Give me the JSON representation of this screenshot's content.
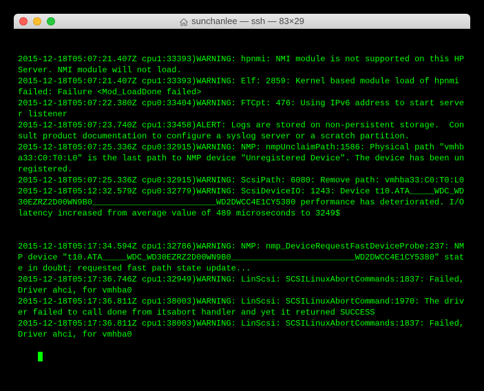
{
  "window": {
    "title": "sunchanlee — ssh — 83×29"
  },
  "terminal": {
    "lines": [
      "2015-12-18T05:07:21.407Z cpu1:33393)WARNING: hpnmi: NMI module is not supported on this HP Server. NMI module will not load.",
      "2015-12-18T05:07:21.407Z cpu1:33393)WARNING: Elf: 2859: Kernel based module load of hpnmi failed: Failure <Mod_LoadDone failed>",
      "2015-12-18T05:07:22.380Z cpu0:33404)WARNING: FTCpt: 476: Using IPv6 address to start server listener",
      "2015-12-18T05:07:23.740Z cpu1:33458)ALERT: Logs are stored on non-persistent storage.  Consult product documentation to configure a syslog server or a scratch partition.",
      "2015-12-18T05:07:25.336Z cpu0:32915)WARNING: NMP: nmpUnclaimPath:1586: Physical path \"vmhba33:C0:T0:L0\" is the last path to NMP device \"Unregistered Device\". The device has been unregistered.",
      "2015-12-18T05:07:25.336Z cpu0:32915)WARNING: ScsiPath: 6080: Remove path: vmhba33:C0:T0:L0",
      "2015-12-18T05:12:32.579Z cpu0:32779)WARNING: ScsiDeviceIO: 1243: Device t10.ATA_____WDC_WD30EZRZ2D00WN9B0_________________________WD2DWCC4E1CY5380 performance has deteriorated. I/O latency increased from average value of 489 microseconds to 3249$",
      "",
      "",
      "2015-12-18T05:17:34.594Z cpu1:32786)WARNING: NMP: nmp_DeviceRequestFastDeviceProbe:237: NMP device \"t10.ATA_____WDC_WD30EZRZ2D00WN9B0_________________________WD2DWCC4E1CY5380\" state in doubt; requested fast path state update...",
      "2015-12-18T05:17:36.746Z cpu1:32949)WARNING: LinScsi: SCSILinuxAbortCommands:1837: Failed, Driver ahci, for vmhba0",
      "2015-12-18T05:17:36.811Z cpu1:38003)WARNING: LinScsi: SCSILinuxAbortCommand:1970: The driver failed to call done from itsabort handler and yet it returned SUCCESS",
      "2015-12-18T05:17:36.811Z cpu1:38003)WARNING: LinScsi: SCSILinuxAbortCommands:1837: Failed, Driver ahci, for vmhba0"
    ]
  }
}
